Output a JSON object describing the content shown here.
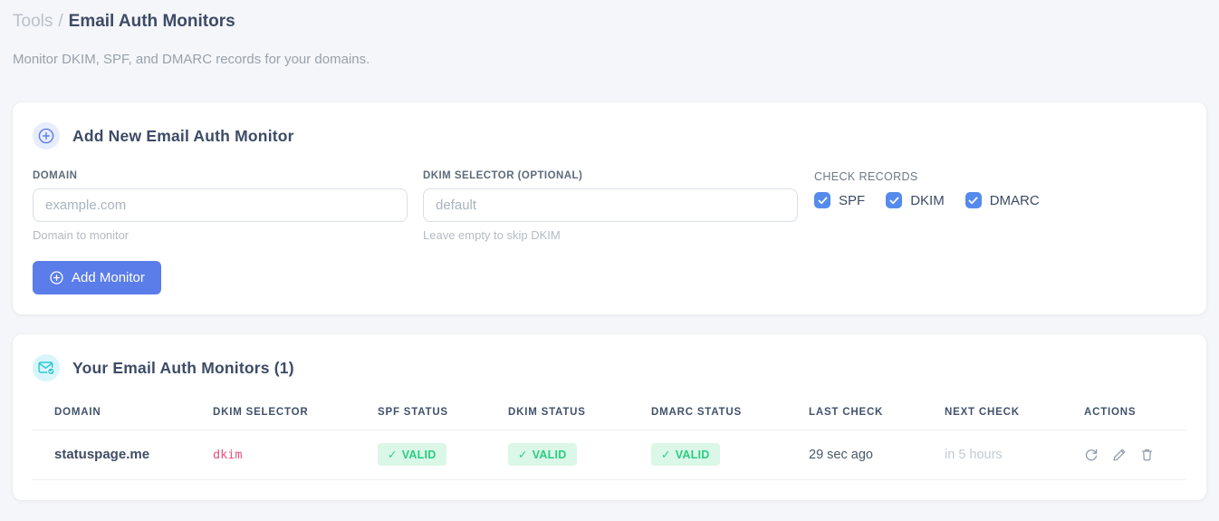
{
  "page": {
    "breadcrumb": {
      "section": "Tools",
      "separator": "/",
      "current": "Email Auth Monitors"
    },
    "subtitle": "Monitor DKIM, SPF, and DMARC records for your domains."
  },
  "add_monitor_card": {
    "title": "Add New Email Auth Monitor",
    "domain_field": {
      "label": "DOMAIN",
      "placeholder": "example.com",
      "value": "",
      "helper": "Domain to monitor"
    },
    "dkim_field": {
      "label": "DKIM SELECTOR (OPTIONAL)",
      "placeholder": "default",
      "value": "",
      "helper": "Leave empty to skip DKIM"
    },
    "check_records": {
      "label": "CHECK RECORDS",
      "options": [
        {
          "label": "SPF",
          "checked": true
        },
        {
          "label": "DKIM",
          "checked": true
        },
        {
          "label": "DMARC",
          "checked": true
        }
      ]
    },
    "submit_label": "Add Monitor"
  },
  "monitors_card": {
    "title": "Your Email Auth Monitors (1)",
    "table": {
      "headers": [
        "DOMAIN",
        "DKIM SELECTOR",
        "SPF STATUS",
        "DKIM STATUS",
        "DMARC STATUS",
        "LAST CHECK",
        "NEXT CHECK",
        "ACTIONS"
      ],
      "rows": [
        {
          "domain": "statuspage.me",
          "dkim_selector": "dkim",
          "spf_status": "VALID",
          "dkim_status": "VALID",
          "dmarc_status": "VALID",
          "last_check": "29 sec ago",
          "next_check": "in 5 hours"
        }
      ]
    }
  },
  "icons": {
    "valid_check": "✓"
  },
  "colors": {
    "primary_blue": "#5a7de9",
    "checkbox_blue": "#548bec",
    "badge_green_bg": "#daf7e8",
    "badge_green_text": "#2bcd83",
    "selector_pink": "#e8517e",
    "teal_icon": "#1ec4d8",
    "page_bg": "#f5f6f9"
  }
}
